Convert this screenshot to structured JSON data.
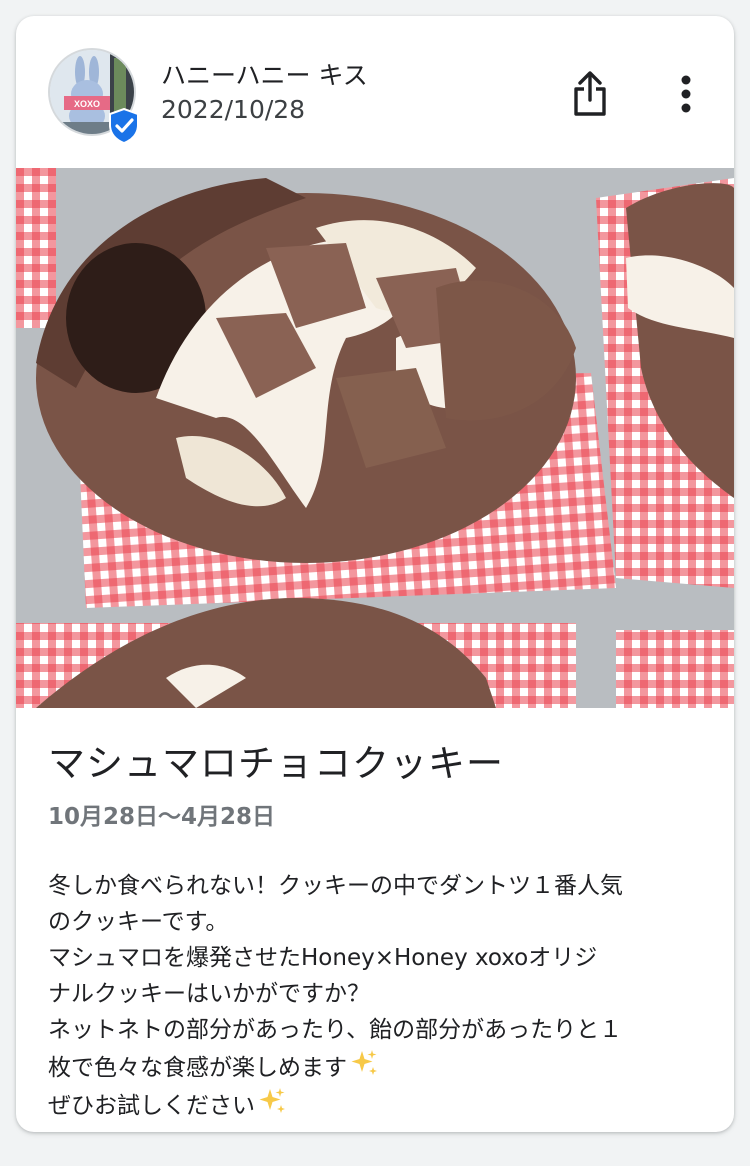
{
  "post": {
    "account_name": "ハニーハニー キス",
    "date": "2022/10/28",
    "avatar_sign_text": "XOXO",
    "title": "マシュマロチョコクッキー",
    "period": "10月28日〜4月28日",
    "description_lines": [
      "冬しか食べられない！クッキーの中でダントツ１番人気",
      "のクッキーです。",
      "マシュマロを爆発させたHoney×Honey  xoxoオリジ",
      "ナルクッキーはいかがですか？",
      "ネットネトの部分があったり、飴の部分があったりと１",
      "枚で色々な食感が楽しめます",
      "ぜひお試しください"
    ]
  },
  "icons": {
    "verified": "verified-badge-icon",
    "share": "share-icon",
    "more": "more-vertical-icon",
    "sparkle": "sparkles-emoji-icon"
  },
  "colors": {
    "card_bg": "#ffffff",
    "page_bg": "#f1f3f4",
    "verified_blue": "#1a73e8",
    "secondary_text": "#70757a",
    "tablecloth_red": "#e8414e",
    "cookie_brown": "#7a5447",
    "marshmallow": "#f7f1e8"
  }
}
